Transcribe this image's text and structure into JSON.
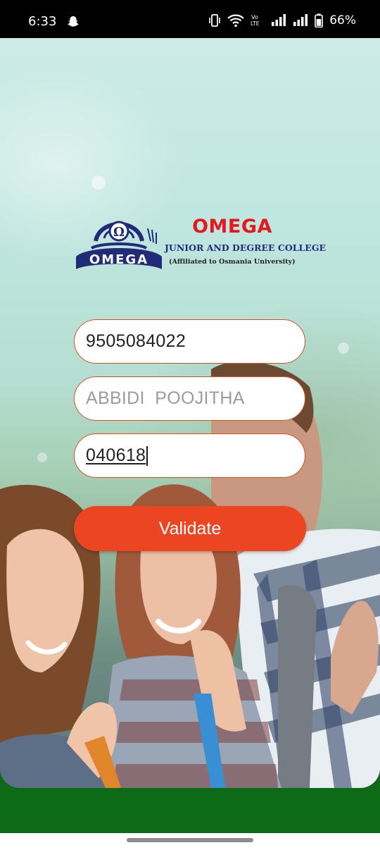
{
  "status_bar": {
    "time": "6:33",
    "battery_percent": "66%",
    "notification_icon": "snapchat-ghost-icon",
    "icons": [
      "vibrate-icon",
      "wifi-icon",
      "volte-icon",
      "signal-icon",
      "signal-icon",
      "battery-icon"
    ]
  },
  "college": {
    "emblem_text": "OMEGA",
    "name": "OMEGA",
    "subtitle": "JUNIOR AND DEGREE COLLEGE",
    "affiliation": "(Affiliated to Osmania University)"
  },
  "form": {
    "phone_value": "9505084022",
    "student_name_value": "ABBIDI  POOJITHA",
    "code_value": "040618",
    "validate_label": "Validate"
  },
  "colors": {
    "accent": "#ec4521",
    "field_border": "#d9501f",
    "footer_green": "#0d6a17",
    "brand_red": "#e3191f",
    "brand_blue": "#202b7a"
  }
}
